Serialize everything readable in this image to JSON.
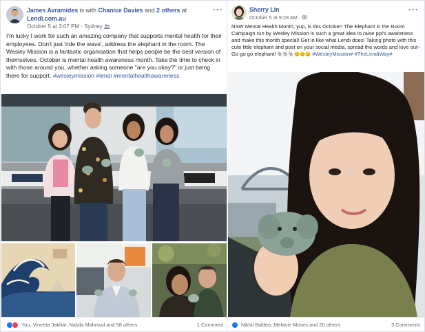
{
  "post_left": {
    "author": "James Avramides",
    "with_text": "is with",
    "tagged": "Chanice Davies",
    "and_text": "and",
    "others": "2 others",
    "at_text": "at",
    "place": "Lendi.com.au",
    "timestamp": "October 5 at 3:07 PM",
    "separator": "·",
    "location": "Sydney",
    "more": "···",
    "text_main": "I'm lucky I work for such an amazing company that supports mental health for their employees. Don't just 'ride the wave', address the elephant in the room. The Wesley Mission is a fantastic organisation that helps people be the best version of themselves. October is mental health awareness month. Take the time to check in with those around you, whether asking someone \"are you okay?\" or just being there for support.",
    "hashtags": [
      "#wesleymission",
      "#lendi",
      "#mentalhealthawareness."
    ],
    "reactions_text": "You, Vineeta Jakhar, Nabila Mahmud and 58 others",
    "comments_text": "1 Comment"
  },
  "post_right": {
    "author": "Sherry Lin",
    "timestamp": "October 5 at 9:28 AM",
    "separator": "·",
    "more": "···",
    "text_main": "NSW Mental Health Month, yup, is this October! The Elephant in the Room Campaign run by Wesley Mission is such a great idea to raise ppl's awareness and make this month special! Get in like what Lendi does! Taking photo with this cute little elephant and post on your social media, spread the words and love out~ Go go go elephant!",
    "emoji_line": "🐘🐘🐘😊😊😊",
    "hashtags": [
      "#WesleyMission#",
      "#TheLendiWay#"
    ],
    "reactions_text": "Nikhil Baldeo, Melanie Moses and 20 others",
    "comments_text": "3 Comments"
  },
  "colors": {
    "link": "#385898",
    "like_blue": "#1877f2",
    "love_red": "#f33e58",
    "haha_yellow": "#f7b125"
  }
}
